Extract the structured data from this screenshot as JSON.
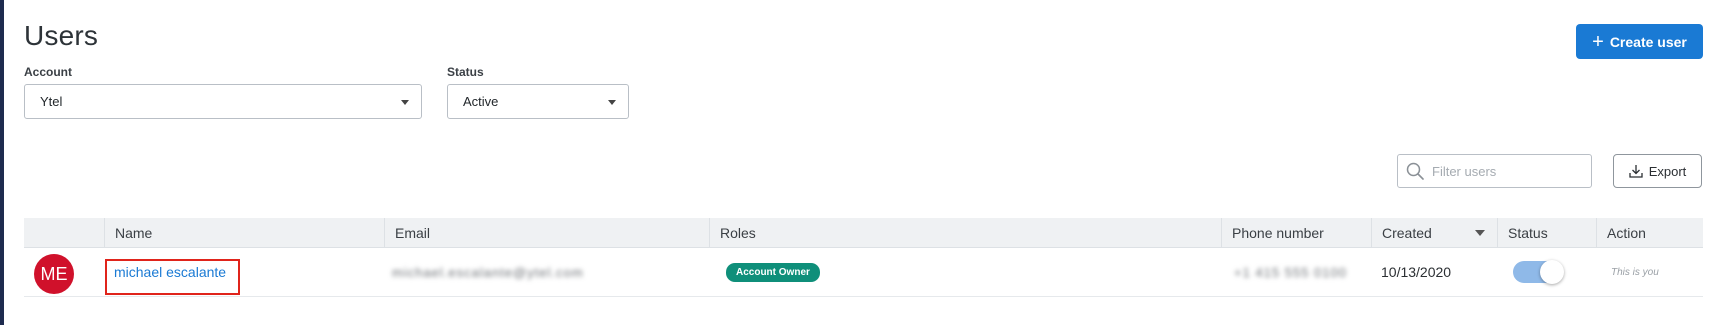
{
  "page": {
    "title": "Users"
  },
  "header": {
    "create_button_label": "Create user"
  },
  "filters": {
    "account": {
      "label": "Account",
      "value": "Ytel"
    },
    "status": {
      "label": "Status",
      "value": "Active"
    }
  },
  "toolbar": {
    "search_placeholder": "Filter users",
    "export_label": "Export"
  },
  "table": {
    "columns": [
      "Name",
      "Email",
      "Roles",
      "Phone number",
      "Created",
      "Status",
      "Action"
    ],
    "sorted_column": "Created",
    "rows": [
      {
        "avatar_initials": "ME",
        "name": "michael escalante",
        "email": "michael.escalante@ytel.com",
        "role": "Account Owner",
        "phone": "+1 415 555 0100",
        "created": "10/13/2020",
        "status_enabled": true,
        "action": "This is you"
      }
    ]
  },
  "colors": {
    "primary": "#1a7ad4",
    "avatar": "#d0112b",
    "role_badge": "#0f8f7a",
    "highlight_box": "#e0241b",
    "toggle_track": "#8fb9e8"
  },
  "icons": {
    "create": "plus-icon",
    "search": "magnifier-icon",
    "export": "download-icon",
    "dropdown": "caret-down-icon"
  }
}
